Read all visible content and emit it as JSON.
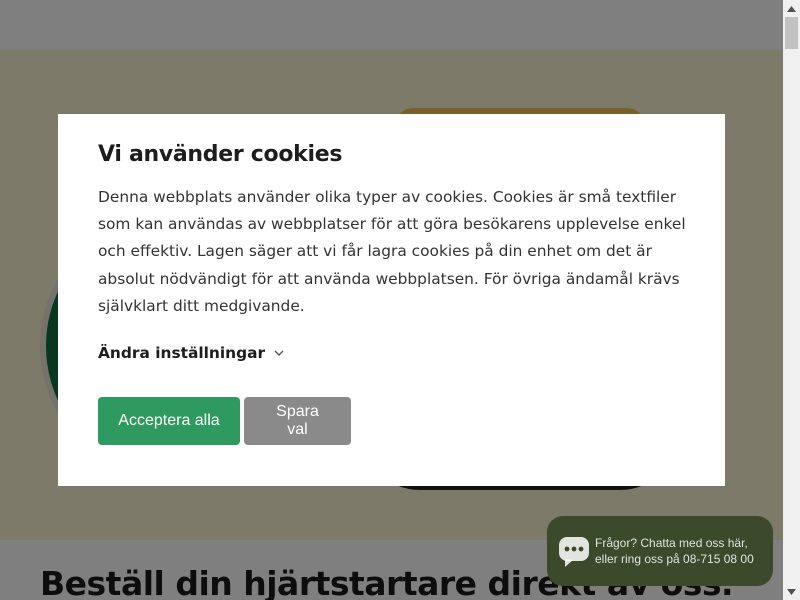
{
  "page": {
    "headline": "Beställ din hjärtstartare direkt av oss."
  },
  "cookie_dialog": {
    "title": "Vi använder cookies",
    "body": "Denna webbplats använder olika typer av cookies. Cookies är små textfiler som kan användas av webbplatser för att göra besökarens upplevelse enkel och effektiv. Lagen säger att vi får lagra cookies på din enhet om det är absolut nödvändigt för att använda webbplatsen. För övriga ändamål krävs självklart ditt medgivande.",
    "settings_label": "Ändra inställningar",
    "settings_icon": "chevron-down-icon",
    "accept_label": "Acceptera alla",
    "save_label": "Spara val"
  },
  "chat_widget": {
    "line1": "Frågor? Chatta med oss här,",
    "line2": "eller ring oss på 08-715 08 00",
    "icon": "chat-bubble-icon"
  },
  "colors": {
    "accept_button": "#2e9a5f",
    "save_button": "#8a8a8a",
    "chat_background": "#3a4a2a",
    "hero_background": "#fbf5d4"
  }
}
